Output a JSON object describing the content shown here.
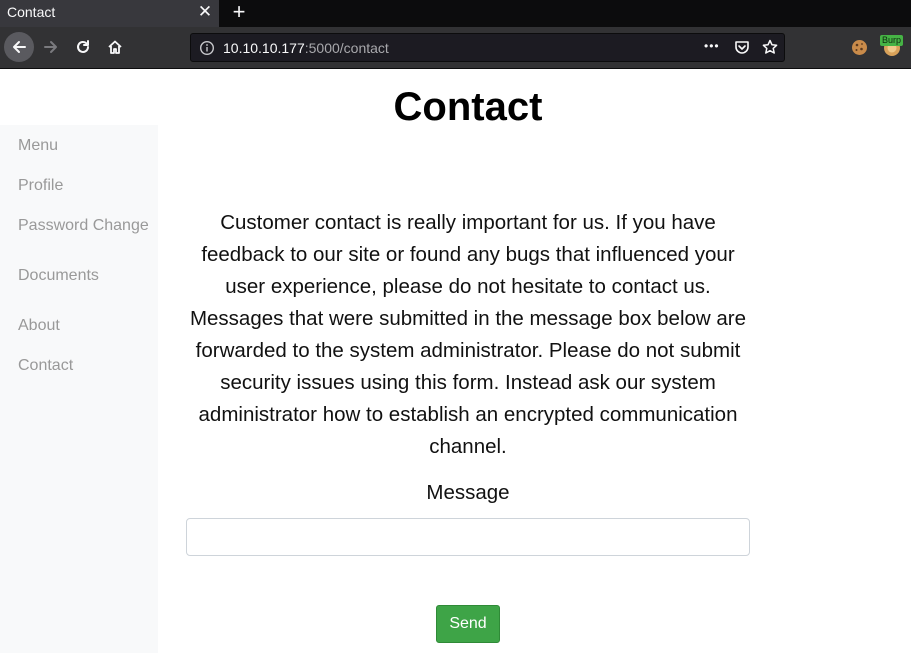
{
  "browser": {
    "tab_title": "Contact",
    "tab_close_glyph": "✕",
    "new_tab_glyph": "+",
    "url_host": "10.10.10.177",
    "url_path": ":5000/contact",
    "url_actions_glyph": "•••",
    "extension_badge": "Burp"
  },
  "sidebar": {
    "items": [
      {
        "label": "Menu"
      },
      {
        "label": "Profile"
      },
      {
        "label": "Password Change"
      },
      {
        "label": "Documents"
      },
      {
        "label": "About"
      },
      {
        "label": "Contact"
      }
    ]
  },
  "main": {
    "title": "Contact",
    "intro": "Customer contact is really important for us. If you have feedback to our site or found any bugs that influenced your user experience, please do not hesitate to contact us. Messages that were submitted in the message box below are forwarded to the system administrator. Please do not submit security issues using this form. Instead ask our system administrator how to establish an encrypted communication channel.",
    "message_label": "Message",
    "message_value": "",
    "send_label": "Send"
  },
  "colors": {
    "chrome_dark": "#0c0c0d",
    "toolbar": "#323234",
    "send_button": "#3ea447",
    "sidebar_bg": "#f8f9fa",
    "sidebar_text": "#999999"
  }
}
